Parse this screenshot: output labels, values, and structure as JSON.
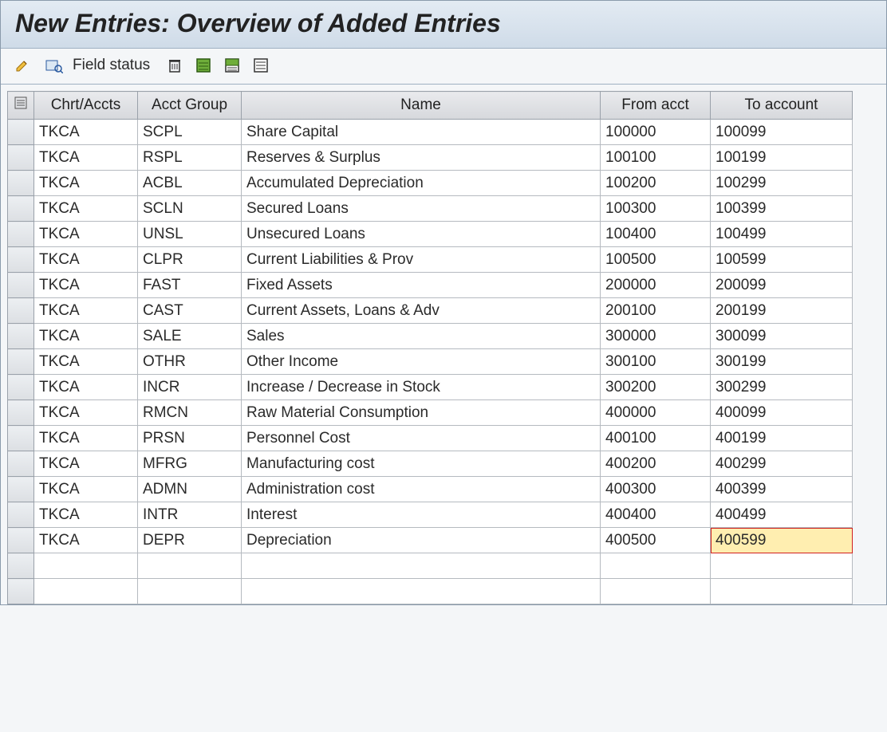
{
  "title": "New Entries: Overview of Added Entries",
  "toolbar": {
    "field_status_label": "Field status"
  },
  "columns": {
    "chrt": "Chrt/Accts",
    "grp": "Acct Group",
    "name": "Name",
    "from": "From acct",
    "to": "To account"
  },
  "rows": [
    {
      "chrt": "TKCA",
      "grp": "SCPL",
      "name": "Share Capital",
      "from": "100000",
      "to": "100099"
    },
    {
      "chrt": "TKCA",
      "grp": "RSPL",
      "name": "Reserves & Surplus",
      "from": "100100",
      "to": "100199"
    },
    {
      "chrt": "TKCA",
      "grp": "ACBL",
      "name": "Accumulated Depreciation",
      "from": "100200",
      "to": "100299"
    },
    {
      "chrt": "TKCA",
      "grp": "SCLN",
      "name": "Secured Loans",
      "from": "100300",
      "to": "100399"
    },
    {
      "chrt": "TKCA",
      "grp": "UNSL",
      "name": "Unsecured Loans",
      "from": "100400",
      "to": "100499"
    },
    {
      "chrt": "TKCA",
      "grp": "CLPR",
      "name": "Current Liabilities & Prov",
      "from": "100500",
      "to": "100599"
    },
    {
      "chrt": "TKCA",
      "grp": "FAST",
      "name": "Fixed Assets",
      "from": "200000",
      "to": "200099"
    },
    {
      "chrt": "TKCA",
      "grp": "CAST",
      "name": "Current Assets, Loans & Adv",
      "from": "200100",
      "to": "200199"
    },
    {
      "chrt": "TKCA",
      "grp": "SALE",
      "name": "Sales",
      "from": "300000",
      "to": "300099"
    },
    {
      "chrt": "TKCA",
      "grp": "OTHR",
      "name": "Other Income",
      "from": "300100",
      "to": "300199"
    },
    {
      "chrt": "TKCA",
      "grp": "INCR",
      "name": "Increase / Decrease in Stock",
      "from": "300200",
      "to": "300299"
    },
    {
      "chrt": "TKCA",
      "grp": "RMCN",
      "name": "Raw Material Consumption",
      "from": "400000",
      "to": "400099"
    },
    {
      "chrt": "TKCA",
      "grp": "PRSN",
      "name": "Personnel Cost",
      "from": "400100",
      "to": "400199"
    },
    {
      "chrt": "TKCA",
      "grp": "MFRG",
      "name": "Manufacturing cost",
      "from": "400200",
      "to": "400299"
    },
    {
      "chrt": "TKCA",
      "grp": "ADMN",
      "name": "Administration cost",
      "from": "400300",
      "to": "400399"
    },
    {
      "chrt": "TKCA",
      "grp": "INTR",
      "name": "Interest",
      "from": "400400",
      "to": "400499"
    },
    {
      "chrt": "TKCA",
      "grp": "DEPR",
      "name": "Depreciation",
      "from": "400500",
      "to": "400599"
    }
  ],
  "active_cell": {
    "row": 16,
    "col": "to"
  },
  "colors": {
    "active_bg": "#ffeeb0",
    "active_border": "#d02020"
  }
}
